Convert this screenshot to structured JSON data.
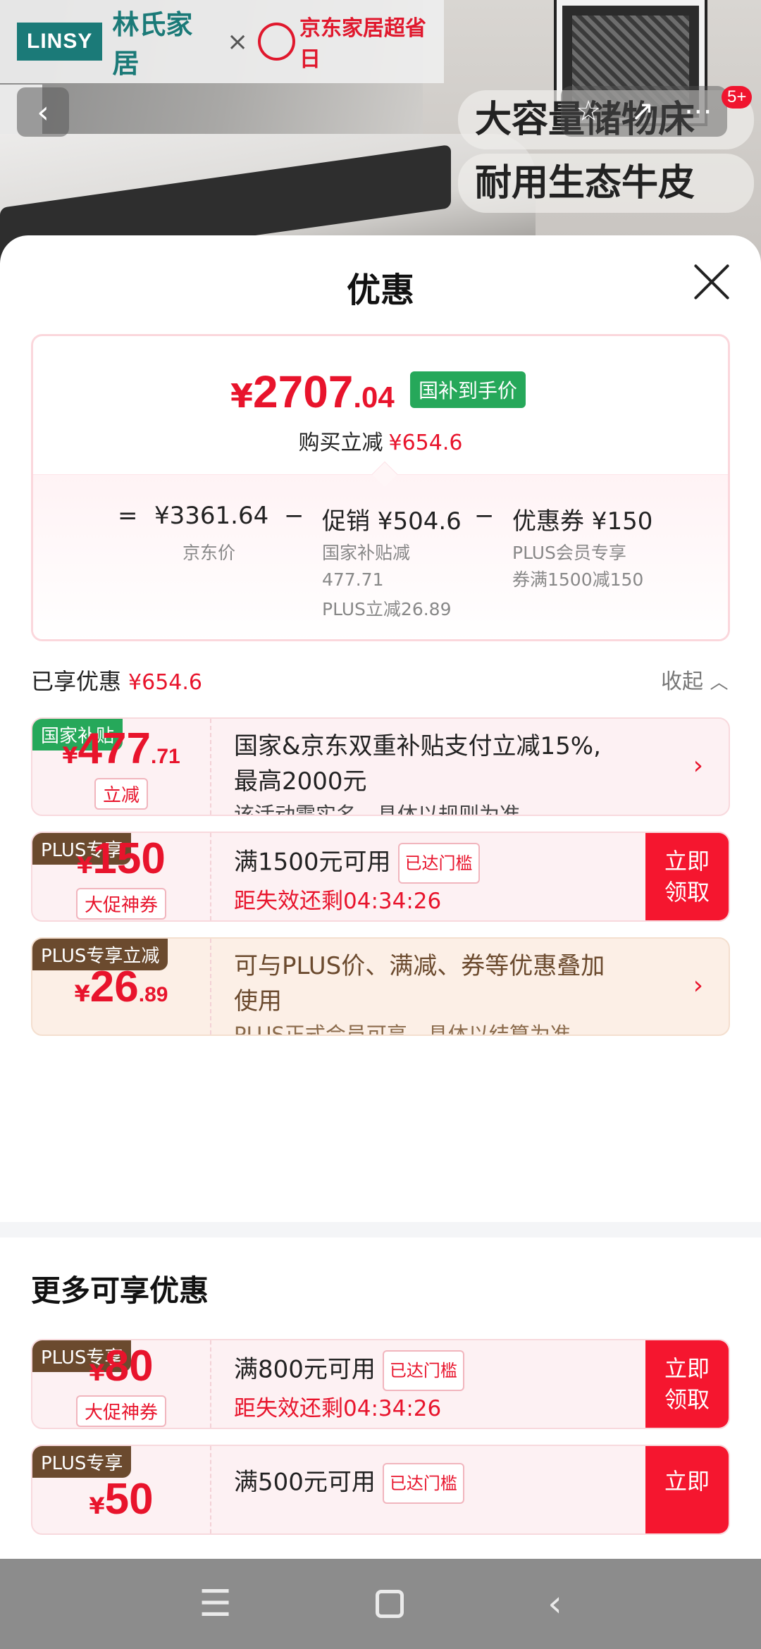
{
  "hero": {
    "brand_en": "LINSY",
    "brand_cn": "林氏家居",
    "collab_x": "×",
    "jd_event": "京东家居超省日",
    "slogan_line1": "大容量储物床",
    "slogan_line2": "耐用生态牛皮",
    "cart_badge": "5+"
  },
  "sheet": {
    "title": "优惠"
  },
  "price": {
    "yen": "¥",
    "int": "2707",
    "dec": ".04",
    "tag": "国补到手价",
    "buy_reduce_label": "购买立减",
    "buy_reduce_value": "¥654.6",
    "eq": "=",
    "minus": "−",
    "jd_price": "¥3361.64",
    "jd_price_label": "京东价",
    "promo": "促销 ¥504.6",
    "promo_sub1": "国家补贴减",
    "promo_sub2": "477.71",
    "promo_sub3": "PLUS立减26.89",
    "coupon": "优惠券 ¥150",
    "coupon_sub1": "PLUS会员专享",
    "coupon_sub2": "券满1500减150"
  },
  "enjoyed": {
    "label": "已享优惠",
    "value": "¥654.6",
    "collapse": "收起"
  },
  "deals": [
    {
      "tag": "国家补贴",
      "yen": "¥",
      "int": "477",
      "dec": ".71",
      "small": "立减",
      "line1": "国家&京东双重补贴支付立减15%,",
      "line2": "最高2000元",
      "line3": "该活动需实名，具体以规则为准"
    },
    {
      "tag": "PLUS专享",
      "yen": "¥",
      "int": "150",
      "small": "大促神券",
      "line1": "满1500元可用",
      "reached": "已达门槛",
      "countdown": "距失效还剩04:34:26",
      "claim": "立即领取"
    },
    {
      "tag": "PLUS专享立减",
      "yen": "¥",
      "int": "26",
      "dec": ".89",
      "line1": "可与PLUS价、满减、券等优惠叠加",
      "line2": "使用",
      "line3": "PLUS正式会员可享，具体以结算为准"
    }
  ],
  "more": {
    "title": "更多可享优惠",
    "items": [
      {
        "tag": "PLUS专享",
        "yen": "¥",
        "int": "80",
        "small": "大促神券",
        "line1": "满800元可用",
        "reached": "已达门槛",
        "countdown": "距失效还剩04:34:26",
        "claim": "立即领取"
      },
      {
        "tag": "PLUS专享",
        "yen": "¥",
        "int": "50",
        "line1": "满500元可用",
        "reached": "已达门槛",
        "claim": "立即"
      }
    ]
  },
  "nav": {
    "menu": "☰",
    "back": "‹"
  }
}
